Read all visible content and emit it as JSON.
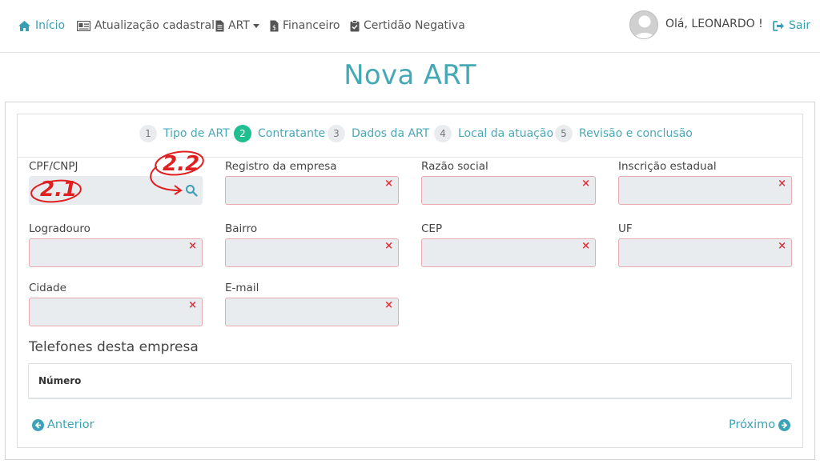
{
  "nav": {
    "home": "Início",
    "registration_update": "Atualização cadastral",
    "art": "ART",
    "financial": "Financeiro",
    "negative_certificate": "Certidão Negativa",
    "greeting": "Olá, LEONARDO !",
    "logout": "Sair"
  },
  "page": {
    "title": "Nova ART"
  },
  "steps": [
    {
      "number": "1",
      "label": "Tipo de ART"
    },
    {
      "number": "2",
      "label": "Contratante"
    },
    {
      "number": "3",
      "label": "Dados da ART"
    },
    {
      "number": "4",
      "label": "Local da atuação"
    },
    {
      "number": "5",
      "label": "Revisão e conclusão"
    }
  ],
  "form": {
    "cpf_cnpj": {
      "label": "CPF/CNPJ",
      "value": ""
    },
    "company_registry": {
      "label": "Registro da empresa",
      "value": ""
    },
    "company_name": {
      "label": "Razão social",
      "value": ""
    },
    "state_registration": {
      "label": "Inscrição estadual",
      "value": ""
    },
    "street": {
      "label": "Logradouro",
      "value": ""
    },
    "district": {
      "label": "Bairro",
      "value": ""
    },
    "zip": {
      "label": "CEP",
      "value": ""
    },
    "state": {
      "label": "UF",
      "value": ""
    },
    "city": {
      "label": "Cidade",
      "value": ""
    },
    "email": {
      "label": "E-mail",
      "value": ""
    },
    "error_mark": "×"
  },
  "phones": {
    "title": "Telefones desta empresa",
    "columns": [
      "Número"
    ]
  },
  "footer": {
    "previous": "Anterior",
    "next": "Próximo"
  },
  "annotations": {
    "a1": "2.1",
    "a2": "2.2"
  },
  "colors": {
    "accent": "#3a9fb3",
    "title": "#45a9b5",
    "active_step": "#1fbf8f",
    "error": "#e0323c",
    "field_bg": "#e9ecef",
    "annotation": "#e02020"
  }
}
